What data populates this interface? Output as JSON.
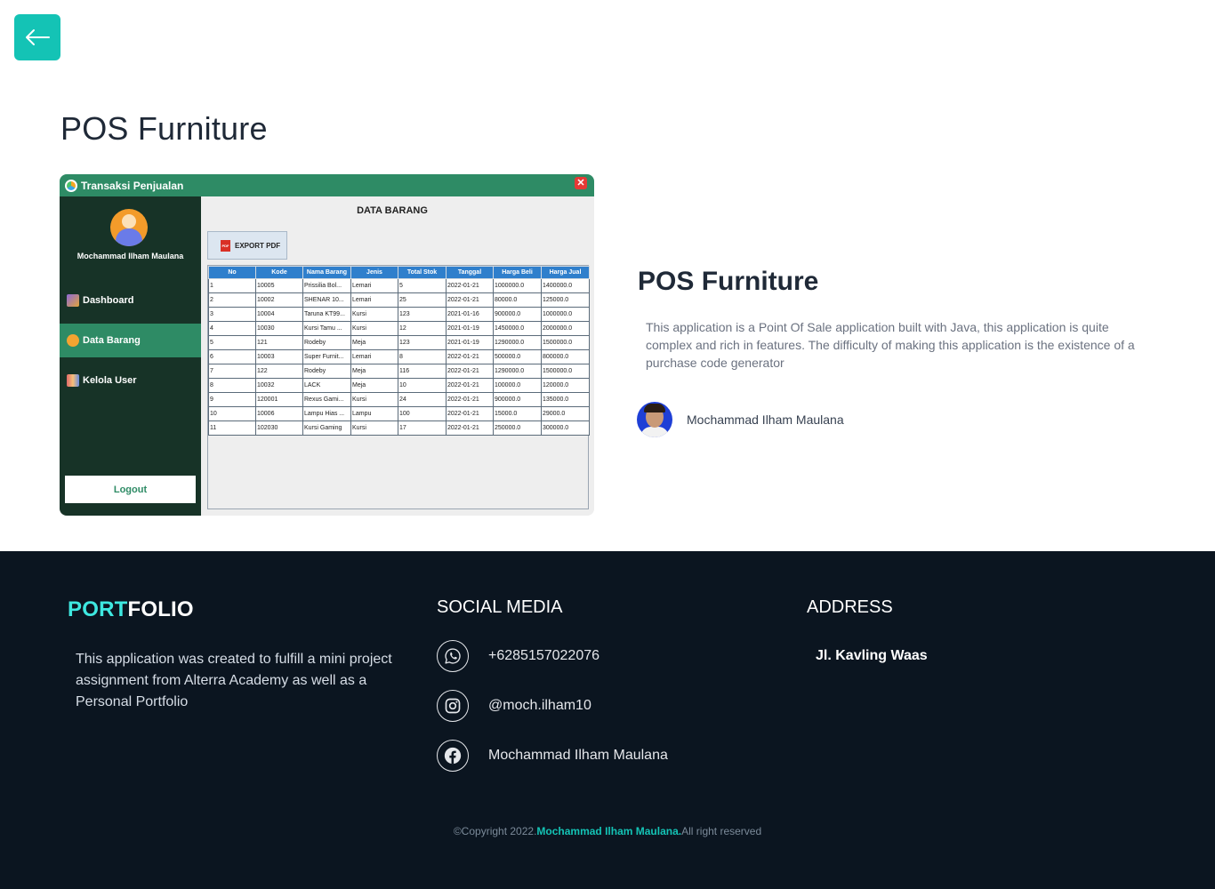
{
  "page": {
    "title": "POS Furniture"
  },
  "screenshot": {
    "window_title": "Transaksi Penjualan",
    "close_label": "✕",
    "user_name": "Mochammad Ilham Maulana",
    "menu": [
      {
        "label": "Dashboard",
        "active": false
      },
      {
        "label": "Data Barang",
        "active": true
      },
      {
        "label": "Kelola User",
        "active": false
      }
    ],
    "logout_label": "Logout",
    "heading": "DATA BARANG",
    "export_label": "EXPORT PDF",
    "pdf_icon_text": "PDF",
    "table": {
      "columns": [
        "No",
        "Kode",
        "Nama Barang",
        "Jenis",
        "Total Stok",
        "Tanggal",
        "Harga Beli",
        "Harga Jual"
      ],
      "rows": [
        [
          "1",
          "10005",
          "Prissilia Bol...",
          "Lemari",
          "5",
          "2022-01-21",
          "1000000.0",
          "1400000.0"
        ],
        [
          "2",
          "10002",
          "SHENAR 10...",
          "Lemari",
          "25",
          "2022-01-21",
          "80000.0",
          "125000.0"
        ],
        [
          "3",
          "10004",
          "Taruna KT99...",
          "Kursi",
          "123",
          "2021-01-16",
          "900000.0",
          "1000000.0"
        ],
        [
          "4",
          "10030",
          "Kursi Tamu ...",
          "Kursi",
          "12",
          "2021-01-19",
          "1450000.0",
          "2000000.0"
        ],
        [
          "5",
          "121",
          "Rodeby",
          "Meja",
          "123",
          "2021-01-19",
          "1290000.0",
          "1500000.0"
        ],
        [
          "6",
          "10003",
          "Super Furnit...",
          "Lemari",
          "8",
          "2022-01-21",
          "500000.0",
          "800000.0"
        ],
        [
          "7",
          "122",
          "Rodeby",
          "Meja",
          "116",
          "2022-01-21",
          "1290000.0",
          "1500000.0"
        ],
        [
          "8",
          "10032",
          "LACK",
          "Meja",
          "10",
          "2022-01-21",
          "100000.0",
          "120000.0"
        ],
        [
          "9",
          "120001",
          "Rexus Gami...",
          "Kursi",
          "24",
          "2022-01-21",
          "900000.0",
          "135000.0"
        ],
        [
          "10",
          "10006",
          "Lampu Hias ...",
          "Lampu",
          "100",
          "2022-01-21",
          "15000.0",
          "29000.0"
        ],
        [
          "11",
          "102030",
          "Kursi Gaming",
          "Kursi",
          "17",
          "2022-01-21",
          "250000.0",
          "300000.0"
        ]
      ]
    }
  },
  "project": {
    "title": "POS Furniture",
    "description": "This application is a Point Of Sale application built with Java, this application is quite complex and rich in features. The difficulty of making this application is the existence of a purchase code generator",
    "author": "Mochammad Ilham Maulana"
  },
  "footer": {
    "brand_part1": "PORT",
    "brand_part2": "FOLIO",
    "about": "This application was created to fulfill a mini project assignment from Alterra Academy as well as a Personal Portfolio",
    "social_heading": "SOCIAL MEDIA",
    "social": [
      {
        "icon": "whatsapp-icon",
        "text": "+6285157022076"
      },
      {
        "icon": "instagram-icon",
        "text": "@moch.ilham10"
      },
      {
        "icon": "facebook-icon",
        "text": "Mochammad Ilham Maulana"
      }
    ],
    "address_heading": "ADDRESS",
    "address": "Jl. Kavling Waas",
    "copyright_prefix": "©Copyright 2022.",
    "copyright_name": "Mochammad Ilham Maulana.",
    "copyright_suffix": "All right reserved"
  },
  "colors": {
    "accent": "#14c3b5",
    "footer_bg": "#0b1520",
    "app_green": "#2e8b65",
    "app_sidebar": "#173327"
  }
}
